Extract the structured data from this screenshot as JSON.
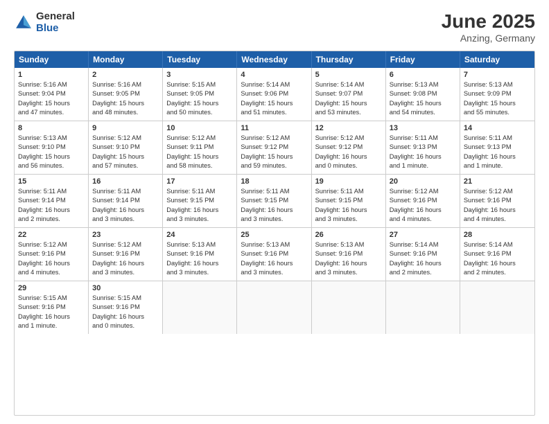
{
  "logo": {
    "general": "General",
    "blue": "Blue"
  },
  "title": "June 2025",
  "location": "Anzing, Germany",
  "header_days": [
    "Sunday",
    "Monday",
    "Tuesday",
    "Wednesday",
    "Thursday",
    "Friday",
    "Saturday"
  ],
  "weeks": [
    [
      {
        "day": "1",
        "lines": [
          "Sunrise: 5:16 AM",
          "Sunset: 9:04 PM",
          "Daylight: 15 hours",
          "and 47 minutes."
        ]
      },
      {
        "day": "2",
        "lines": [
          "Sunrise: 5:16 AM",
          "Sunset: 9:05 PM",
          "Daylight: 15 hours",
          "and 48 minutes."
        ]
      },
      {
        "day": "3",
        "lines": [
          "Sunrise: 5:15 AM",
          "Sunset: 9:05 PM",
          "Daylight: 15 hours",
          "and 50 minutes."
        ]
      },
      {
        "day": "4",
        "lines": [
          "Sunrise: 5:14 AM",
          "Sunset: 9:06 PM",
          "Daylight: 15 hours",
          "and 51 minutes."
        ]
      },
      {
        "day": "5",
        "lines": [
          "Sunrise: 5:14 AM",
          "Sunset: 9:07 PM",
          "Daylight: 15 hours",
          "and 53 minutes."
        ]
      },
      {
        "day": "6",
        "lines": [
          "Sunrise: 5:13 AM",
          "Sunset: 9:08 PM",
          "Daylight: 15 hours",
          "and 54 minutes."
        ]
      },
      {
        "day": "7",
        "lines": [
          "Sunrise: 5:13 AM",
          "Sunset: 9:09 PM",
          "Daylight: 15 hours",
          "and 55 minutes."
        ]
      }
    ],
    [
      {
        "day": "8",
        "lines": [
          "Sunrise: 5:13 AM",
          "Sunset: 9:10 PM",
          "Daylight: 15 hours",
          "and 56 minutes."
        ]
      },
      {
        "day": "9",
        "lines": [
          "Sunrise: 5:12 AM",
          "Sunset: 9:10 PM",
          "Daylight: 15 hours",
          "and 57 minutes."
        ]
      },
      {
        "day": "10",
        "lines": [
          "Sunrise: 5:12 AM",
          "Sunset: 9:11 PM",
          "Daylight: 15 hours",
          "and 58 minutes."
        ]
      },
      {
        "day": "11",
        "lines": [
          "Sunrise: 5:12 AM",
          "Sunset: 9:12 PM",
          "Daylight: 15 hours",
          "and 59 minutes."
        ]
      },
      {
        "day": "12",
        "lines": [
          "Sunrise: 5:12 AM",
          "Sunset: 9:12 PM",
          "Daylight: 16 hours",
          "and 0 minutes."
        ]
      },
      {
        "day": "13",
        "lines": [
          "Sunrise: 5:11 AM",
          "Sunset: 9:13 PM",
          "Daylight: 16 hours",
          "and 1 minute."
        ]
      },
      {
        "day": "14",
        "lines": [
          "Sunrise: 5:11 AM",
          "Sunset: 9:13 PM",
          "Daylight: 16 hours",
          "and 1 minute."
        ]
      }
    ],
    [
      {
        "day": "15",
        "lines": [
          "Sunrise: 5:11 AM",
          "Sunset: 9:14 PM",
          "Daylight: 16 hours",
          "and 2 minutes."
        ]
      },
      {
        "day": "16",
        "lines": [
          "Sunrise: 5:11 AM",
          "Sunset: 9:14 PM",
          "Daylight: 16 hours",
          "and 3 minutes."
        ]
      },
      {
        "day": "17",
        "lines": [
          "Sunrise: 5:11 AM",
          "Sunset: 9:15 PM",
          "Daylight: 16 hours",
          "and 3 minutes."
        ]
      },
      {
        "day": "18",
        "lines": [
          "Sunrise: 5:11 AM",
          "Sunset: 9:15 PM",
          "Daylight: 16 hours",
          "and 3 minutes."
        ]
      },
      {
        "day": "19",
        "lines": [
          "Sunrise: 5:11 AM",
          "Sunset: 9:15 PM",
          "Daylight: 16 hours",
          "and 3 minutes."
        ]
      },
      {
        "day": "20",
        "lines": [
          "Sunrise: 5:12 AM",
          "Sunset: 9:16 PM",
          "Daylight: 16 hours",
          "and 4 minutes."
        ]
      },
      {
        "day": "21",
        "lines": [
          "Sunrise: 5:12 AM",
          "Sunset: 9:16 PM",
          "Daylight: 16 hours",
          "and 4 minutes."
        ]
      }
    ],
    [
      {
        "day": "22",
        "lines": [
          "Sunrise: 5:12 AM",
          "Sunset: 9:16 PM",
          "Daylight: 16 hours",
          "and 4 minutes."
        ]
      },
      {
        "day": "23",
        "lines": [
          "Sunrise: 5:12 AM",
          "Sunset: 9:16 PM",
          "Daylight: 16 hours",
          "and 3 minutes."
        ]
      },
      {
        "day": "24",
        "lines": [
          "Sunrise: 5:13 AM",
          "Sunset: 9:16 PM",
          "Daylight: 16 hours",
          "and 3 minutes."
        ]
      },
      {
        "day": "25",
        "lines": [
          "Sunrise: 5:13 AM",
          "Sunset: 9:16 PM",
          "Daylight: 16 hours",
          "and 3 minutes."
        ]
      },
      {
        "day": "26",
        "lines": [
          "Sunrise: 5:13 AM",
          "Sunset: 9:16 PM",
          "Daylight: 16 hours",
          "and 3 minutes."
        ]
      },
      {
        "day": "27",
        "lines": [
          "Sunrise: 5:14 AM",
          "Sunset: 9:16 PM",
          "Daylight: 16 hours",
          "and 2 minutes."
        ]
      },
      {
        "day": "28",
        "lines": [
          "Sunrise: 5:14 AM",
          "Sunset: 9:16 PM",
          "Daylight: 16 hours",
          "and 2 minutes."
        ]
      }
    ],
    [
      {
        "day": "29",
        "lines": [
          "Sunrise: 5:15 AM",
          "Sunset: 9:16 PM",
          "Daylight: 16 hours",
          "and 1 minute."
        ]
      },
      {
        "day": "30",
        "lines": [
          "Sunrise: 5:15 AM",
          "Sunset: 9:16 PM",
          "Daylight: 16 hours",
          "and 0 minutes."
        ]
      },
      {
        "day": "",
        "lines": []
      },
      {
        "day": "",
        "lines": []
      },
      {
        "day": "",
        "lines": []
      },
      {
        "day": "",
        "lines": []
      },
      {
        "day": "",
        "lines": []
      }
    ]
  ]
}
